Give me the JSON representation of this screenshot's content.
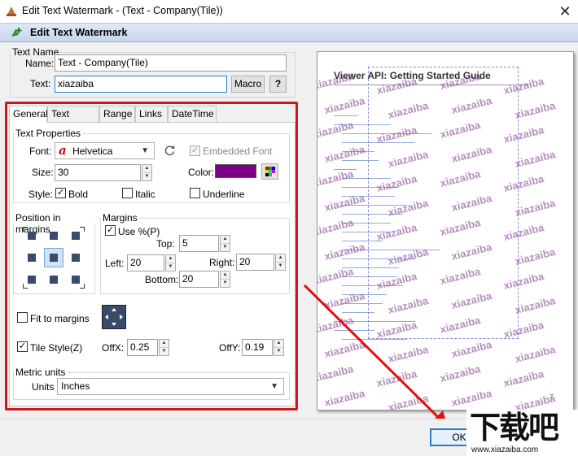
{
  "window": {
    "title": "Edit Text Watermark - (Text - Company(Tile))",
    "close_glyph": "✕"
  },
  "header": {
    "title": "Edit Text Watermark"
  },
  "text_name": {
    "legend": "Text Name",
    "name_label": "Name:",
    "name_value": "Text - Company(Tile)",
    "text_label": "Text:",
    "text_value": "xiazaiba",
    "macro_label": "Macro",
    "help_label": "?"
  },
  "tabs": [
    "General",
    "Text Effect",
    "Range",
    "Links",
    "DateTime"
  ],
  "text_properties": {
    "legend": "Text Properties",
    "font_label": "Font:",
    "font_value": "Helvetica",
    "embedded_font_label": "Embedded Font",
    "size_label": "Size:",
    "size_value": "30",
    "color_label": "Color:",
    "color_value": "#7a0086",
    "style_label": "Style:",
    "bold_label": "Bold",
    "italic_label": "Italic",
    "underline_label": "Underline"
  },
  "position": {
    "legend": "Position in margins"
  },
  "margins": {
    "legend": "Margins",
    "use_percent_label": "Use %(P)",
    "top_label": "Top:",
    "top_value": "5",
    "left_label": "Left:",
    "left_value": "20",
    "right_label": "Right:",
    "right_value": "20",
    "bottom_label": "Bottom:",
    "bottom_value": "20"
  },
  "fit_to_margins_label": "Fit to margins",
  "tile_style_label": "Tile Style(Z)",
  "offx_label": "OffX:",
  "offx_value": "0.25",
  "offy_label": "OffY:",
  "offy_value": "0.19",
  "metric": {
    "legend": "Metric units",
    "units_label": "Units",
    "units_value": "Inches"
  },
  "preview": {
    "doc_title": "Viewer API: Getting Started Guide",
    "watermark_text": "xiazaiba",
    "page_marker": "7"
  },
  "ok_label": "OK",
  "brand_logo": {
    "text": "下载吧",
    "url": "www.xiazaiba.com"
  }
}
